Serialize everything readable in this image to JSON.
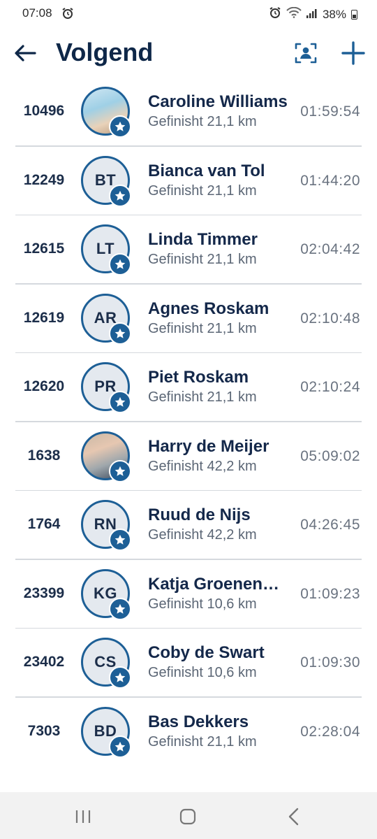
{
  "status_bar": {
    "time": "07:08",
    "battery": "38%",
    "icons": [
      "alarm-icon",
      "wifi-icon",
      "signal-icon",
      "battery-icon"
    ]
  },
  "header": {
    "title": "Volgend",
    "back_icon": "arrow-left-icon",
    "scan_icon": "scan-person-icon",
    "add_icon": "plus-icon"
  },
  "followers": [
    {
      "bib": "10496",
      "initials": "",
      "name": "Caroline Williams",
      "status": "Gefinisht 21,1 km",
      "time": "01:59:54",
      "photo": true
    },
    {
      "bib": "12249",
      "initials": "BT",
      "name": "Bianca van Tol",
      "status": "Gefinisht 21,1 km",
      "time": "01:44:20",
      "photo": false
    },
    {
      "bib": "12615",
      "initials": "LT",
      "name": "Linda Timmer",
      "status": "Gefinisht 21,1 km",
      "time": "02:04:42",
      "photo": false
    },
    {
      "bib": "12619",
      "initials": "AR",
      "name": "Agnes Roskam",
      "status": "Gefinisht 21,1 km",
      "time": "02:10:48",
      "photo": false
    },
    {
      "bib": "12620",
      "initials": "PR",
      "name": "Piet Roskam",
      "status": "Gefinisht 21,1 km",
      "time": "02:10:24",
      "photo": false
    },
    {
      "bib": "1638",
      "initials": "",
      "name": "Harry de Meijer",
      "status": "Gefinisht 42,2 km",
      "time": "05:09:02",
      "photo": true
    },
    {
      "bib": "1764",
      "initials": "RN",
      "name": "Ruud de Nijs",
      "status": "Gefinisht 42,2 km",
      "time": "04:26:45",
      "photo": false
    },
    {
      "bib": "23399",
      "initials": "KG",
      "name": "Katja Groenendijk",
      "status": "Gefinisht 10,6 km",
      "time": "01:09:23",
      "photo": false
    },
    {
      "bib": "23402",
      "initials": "CS",
      "name": "Coby de Swart",
      "status": "Gefinisht 10,6 km",
      "time": "01:09:30",
      "photo": false
    },
    {
      "bib": "7303",
      "initials": "BD",
      "name": "Bas Dekkers",
      "status": "Gefinisht 21,1 km",
      "time": "02:28:04",
      "photo": false
    }
  ],
  "nav_bar": {
    "icons": [
      "recents-icon",
      "home-icon",
      "back-icon"
    ]
  },
  "colors": {
    "accent": "#1d5f96",
    "title": "#0e2748",
    "subtext": "#5b6675",
    "divider": "#d5d9de"
  }
}
